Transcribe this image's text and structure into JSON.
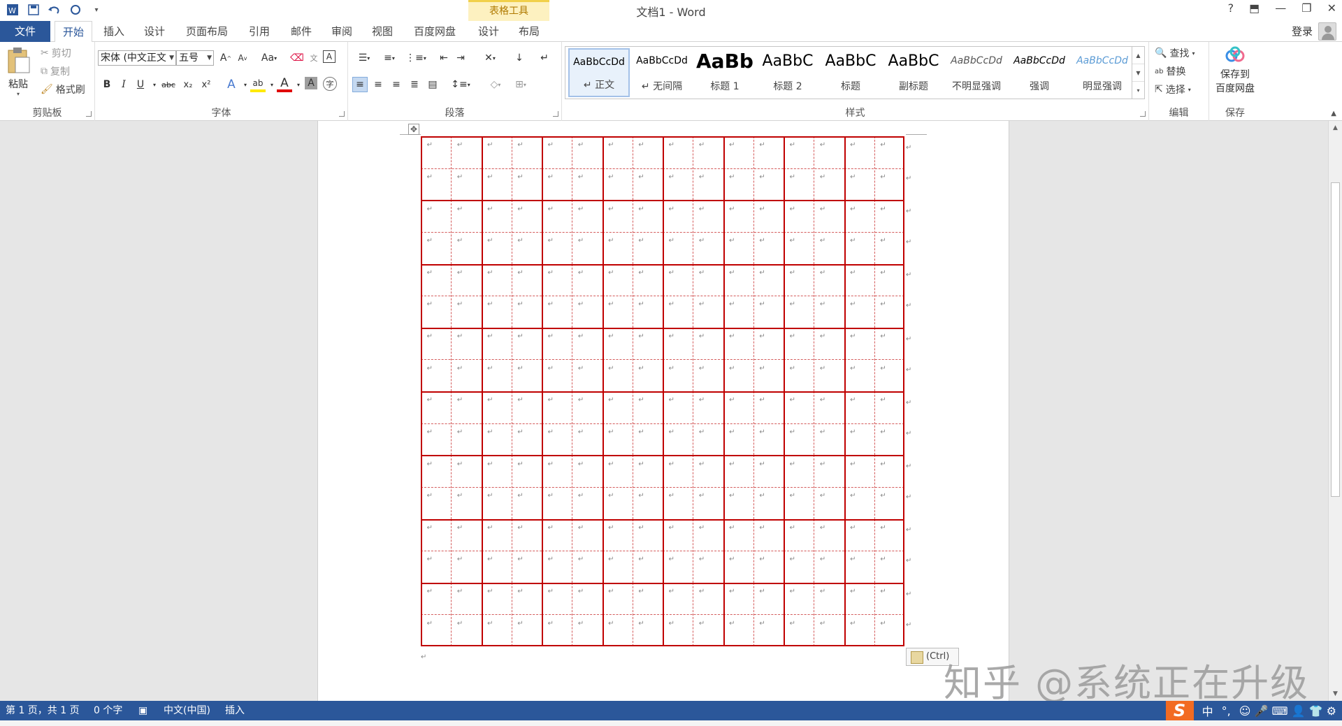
{
  "window": {
    "title": "文档1 - Word",
    "context_tab_header": "表格工具",
    "help": "?",
    "ribbon_display": "⬒",
    "minimize": "—",
    "restore": "❐",
    "close": "✕"
  },
  "tabs": {
    "file": "文件",
    "items": [
      "开始",
      "插入",
      "设计",
      "页面布局",
      "引用",
      "邮件",
      "审阅",
      "视图",
      "百度网盘",
      "设计",
      "布局"
    ],
    "login": "登录"
  },
  "ribbon": {
    "clipboard": {
      "label": "剪贴板",
      "paste": "粘贴",
      "cut": "剪切",
      "copy": "复制",
      "format_painter": "格式刷"
    },
    "font": {
      "label": "字体",
      "font_name": "宋体 (中文正文",
      "font_size": "五号",
      "grow": "A",
      "shrink": "A",
      "change_case": "Aa",
      "bold": "B",
      "italic": "I",
      "underline": "U",
      "strike": "abc",
      "subscript": "x₂",
      "superscript": "x²",
      "text_effect": "A",
      "highlight": "ab",
      "font_color": "A",
      "char_shade": "A",
      "enclose": "字"
    },
    "paragraph": {
      "label": "段落"
    },
    "styles": {
      "label": "样式",
      "items": [
        {
          "sample": "AaBbCcDd",
          "name": "↵ 正文"
        },
        {
          "sample": "AaBbCcDd",
          "name": "↵ 无间隔"
        },
        {
          "sample": "AaBb",
          "name": "标题 1"
        },
        {
          "sample": "AaBbC",
          "name": "标题 2"
        },
        {
          "sample": "AaBbC",
          "name": "标题"
        },
        {
          "sample": "AaBbC",
          "name": "副标题"
        },
        {
          "sample": "AaBbCcDd",
          "name": "不明显强调"
        },
        {
          "sample": "AaBbCcDd",
          "name": "强调"
        },
        {
          "sample": "AaBbCcDd",
          "name": "明显强调"
        }
      ]
    },
    "editing": {
      "label": "编辑",
      "find": "查找",
      "replace": "替换",
      "select": "选择"
    },
    "save": {
      "label": "保存",
      "line1": "保存到",
      "line2": "百度网盘"
    }
  },
  "document": {
    "table": {
      "rows": 8,
      "cols": 8,
      "grid_color": "#c00000",
      "guide_color": "#d45b5b"
    },
    "para_mark": "↵",
    "move_handle": "✥",
    "paste_options": "(Ctrl)"
  },
  "watermark": "知乎 @系统正在升级",
  "statusbar": {
    "page": "第 1 页，共 1 页",
    "words": "0 个字",
    "language": "中文(中国)",
    "mode": "插入",
    "ime_logo": "S",
    "ime_lang": "中",
    "ime_punct": "°,",
    "ime_icons": "☺ 🎤 ⌨ 👤 👕 ⚙"
  }
}
